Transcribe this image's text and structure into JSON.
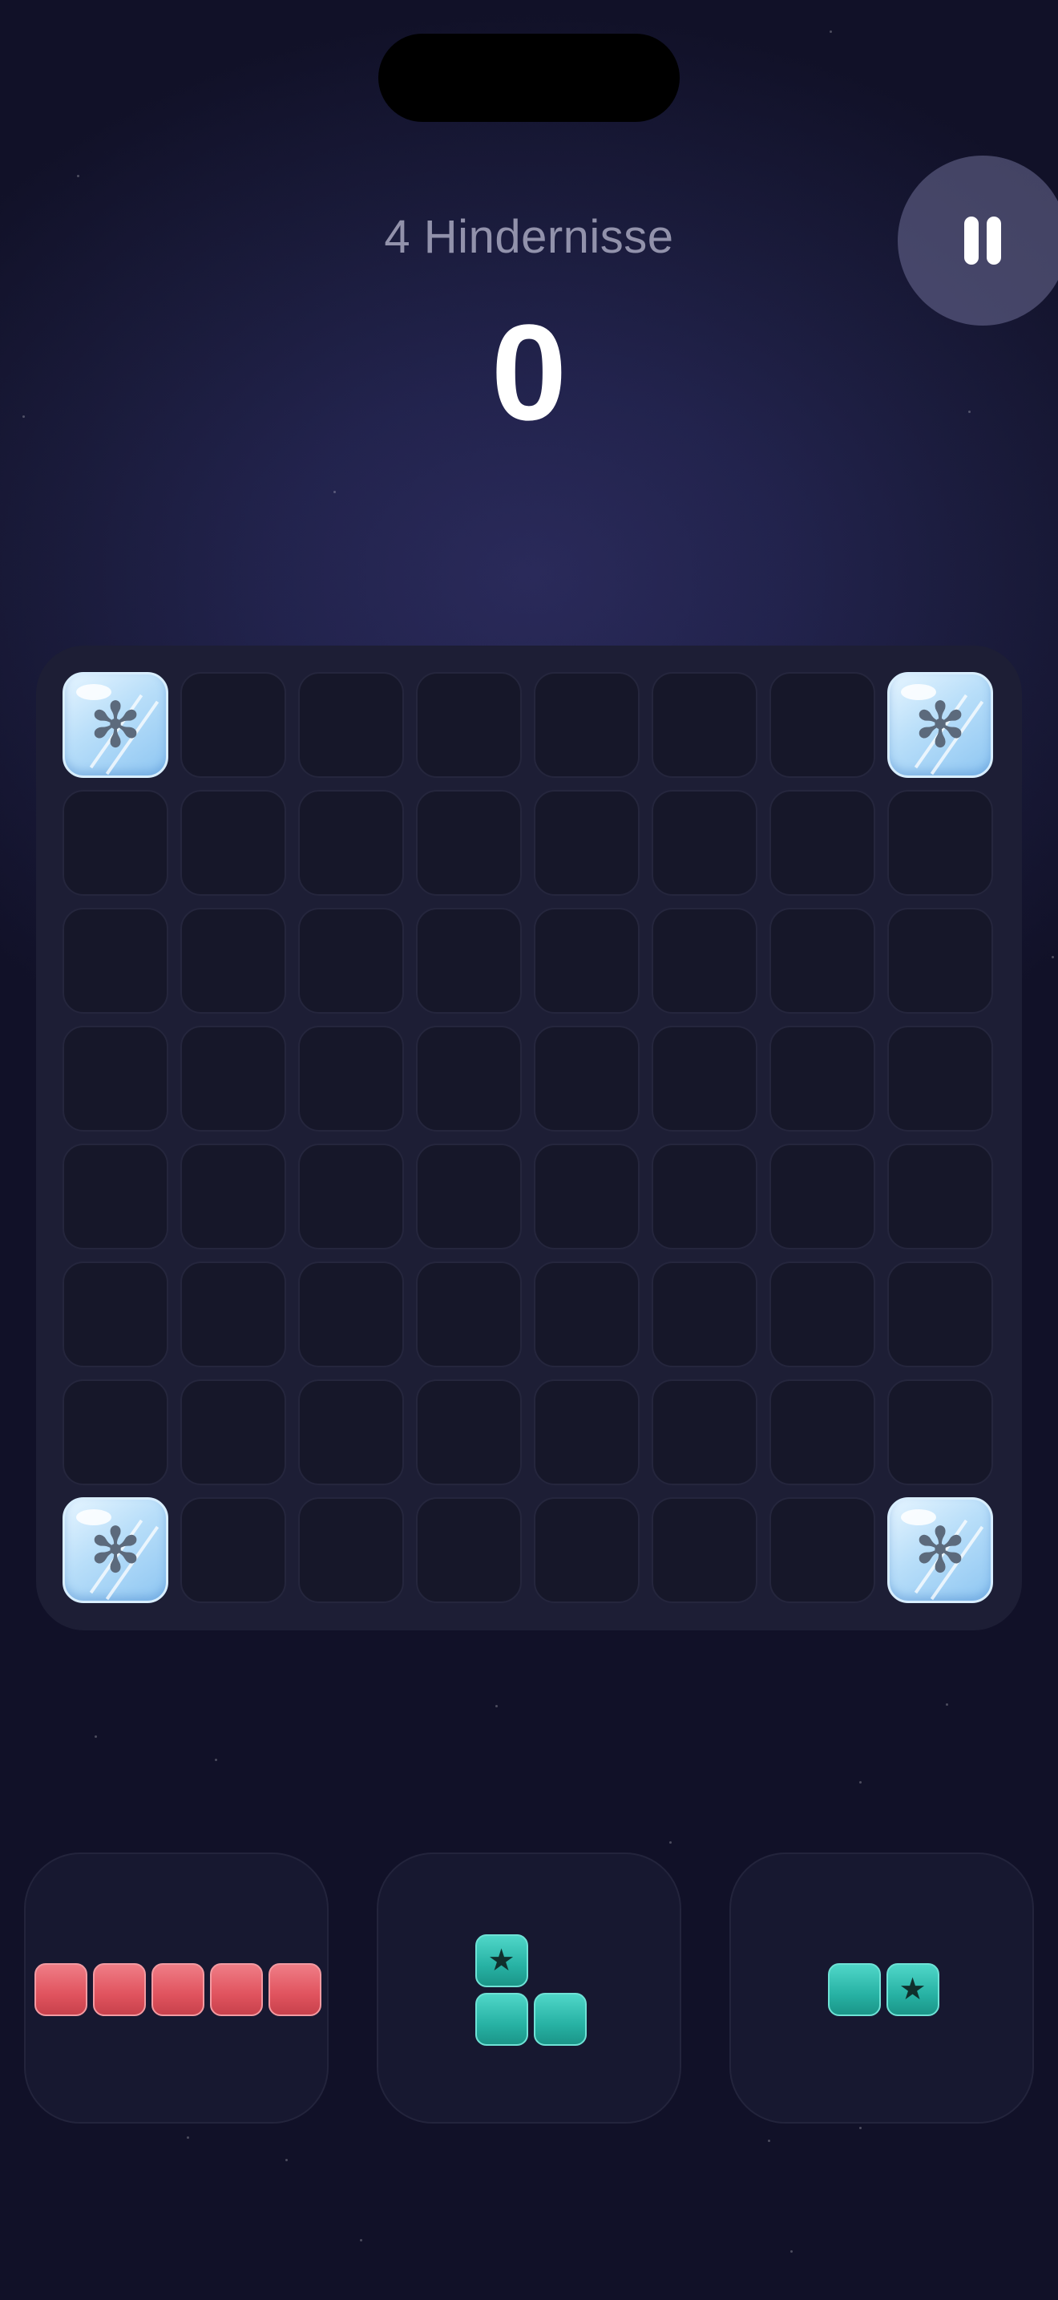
{
  "header": {
    "obstacles_label": "4 Hindernisse",
    "score": "0"
  },
  "controls": {
    "pause_icon": "pause-icon"
  },
  "board": {
    "rows": 8,
    "cols": 8,
    "obstacle_icon": "snowflake-icon",
    "obstacle_glyph": "✻",
    "obstacles": [
      {
        "row": 0,
        "col": 0
      },
      {
        "row": 0,
        "col": 7
      },
      {
        "row": 7,
        "col": 0
      },
      {
        "row": 7,
        "col": 7
      }
    ]
  },
  "pieces": [
    {
      "name": "piece-red-line-5",
      "color": "#e0535e",
      "cells": [
        [
          0,
          0
        ],
        [
          0,
          1
        ],
        [
          0,
          2
        ],
        [
          0,
          3
        ],
        [
          0,
          4
        ]
      ],
      "star_cells": []
    },
    {
      "name": "piece-teal-corner",
      "color": "#27b2a4",
      "cells": [
        [
          0,
          0
        ],
        [
          1,
          0
        ],
        [
          1,
          1
        ]
      ],
      "star_cells": [
        [
          0,
          0
        ]
      ]
    },
    {
      "name": "piece-teal-domino",
      "color": "#27b2a4",
      "cells": [
        [
          0,
          0
        ],
        [
          0,
          1
        ]
      ],
      "star_cells": [
        [
          0,
          1
        ]
      ]
    }
  ],
  "star_glyph": "★"
}
